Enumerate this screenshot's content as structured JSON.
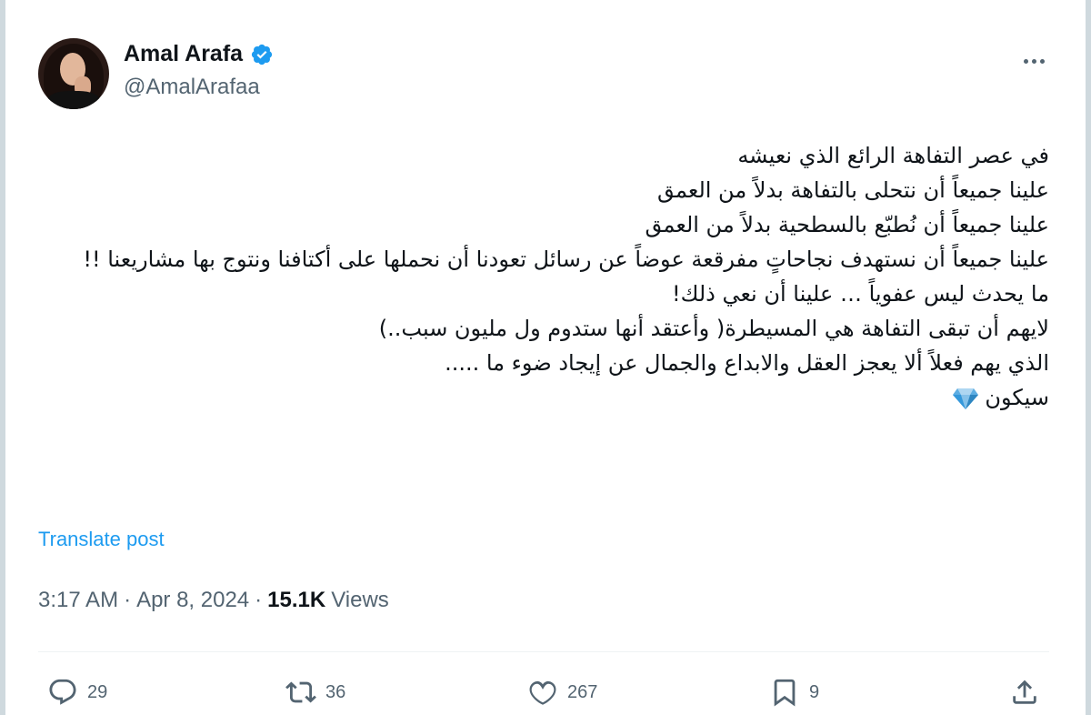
{
  "author": {
    "display_name": "Amal Arafa",
    "handle": "@AmalArafaa",
    "verified_icon": "verified-badge-icon",
    "avatar": "avatar-photo"
  },
  "tweet": {
    "lines": [
      "في عصر التفاهة الرائع الذي نعيشه",
      "علينا جميعاً أن نتحلى بالتفاهة بدلاً من العمق",
      "علينا جميعاً أن نُطبّع بالسطحية بدلاً من العمق",
      "علينا جميعاً أن نستهدف نجاحاتٍ مفرقعة عوضاً عن رسائل تعودنا أن نحملها على أكتافنا  ونتوج بها مشاريعنا !!",
      "ما يحدث ليس عفوياً … علينا أن نعي ذلك!",
      "لايهم أن تبقى التفاهة هي المسيطرة( وأعتقد أنها ستدوم ول مليون سبب..)",
      "الذي يهم فعلاً ألا يعجز العقل والابداع والجمال عن إيجاد  ضوء ما .....",
      "سيكون"
    ],
    "emoji": "gem-stone-icon",
    "translate_label": "Translate post"
  },
  "meta": {
    "time": "3:17 AM",
    "date": "Apr 8, 2024",
    "views_count": "15.1K",
    "views_label": "Views",
    "separator": "·"
  },
  "actions": {
    "replies": "29",
    "reposts": "36",
    "likes": "267",
    "bookmarks": "9"
  },
  "colors": {
    "accent": "#1d9bf0",
    "text": "#0f1419",
    "muted": "#536471"
  }
}
